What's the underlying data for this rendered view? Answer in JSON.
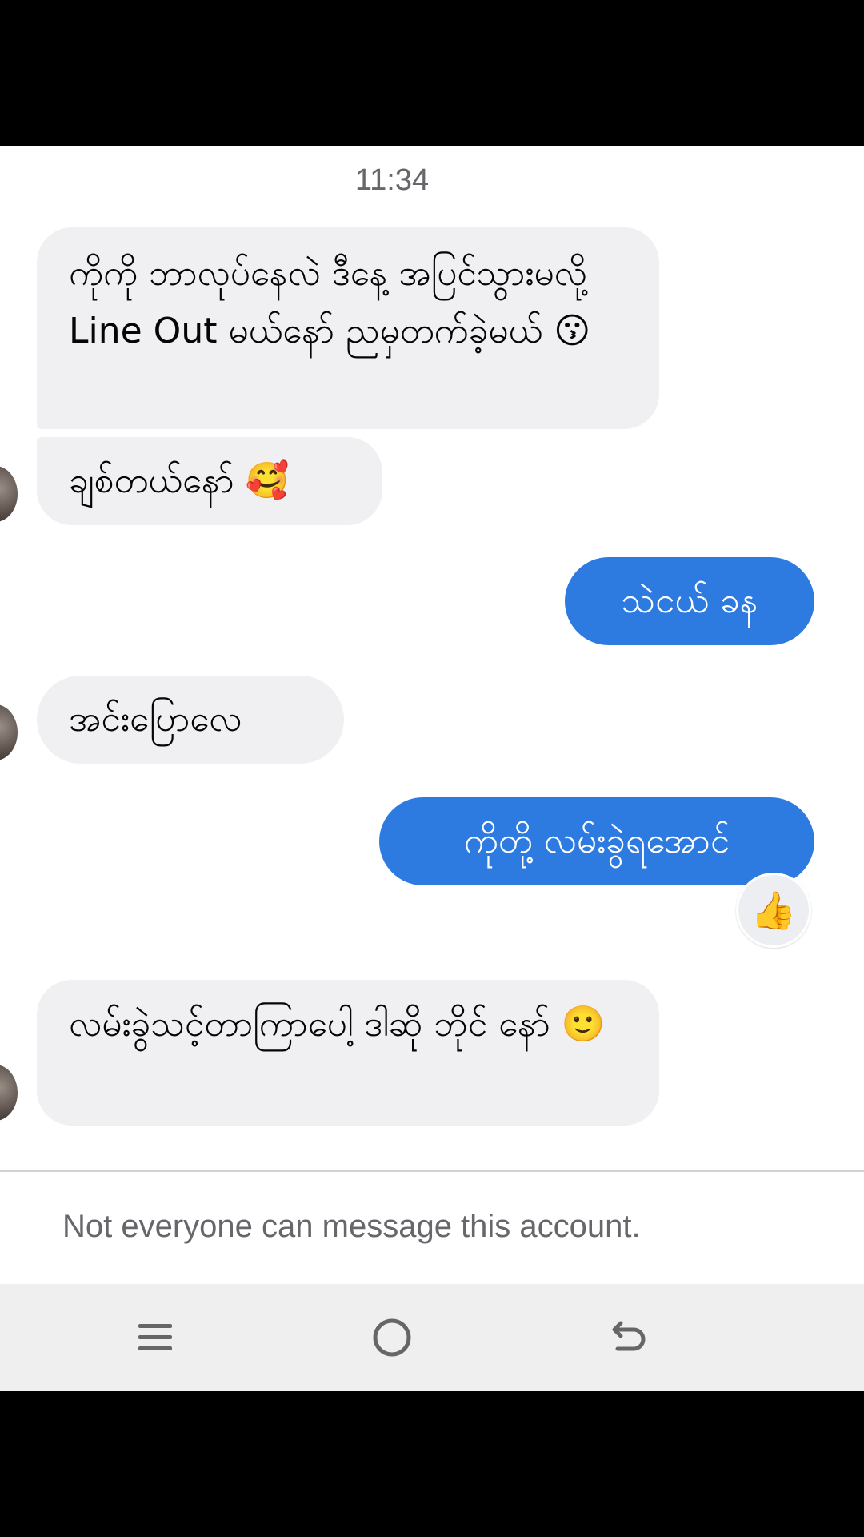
{
  "chat": {
    "timestamp": "11:34",
    "messages": [
      {
        "side": "incoming",
        "text": "ကိုကို ဘာလုပ်နေလဲ ဒီနေ့ အပြင်သွားမလို့ Line Out မယ်နော် ညမှတက်ခဲ့မယ်",
        "emoji": "😗"
      },
      {
        "side": "incoming",
        "text": "ချစ်တယ်နော်",
        "emoji": "🥰"
      },
      {
        "side": "outgoing",
        "text": "သဲငယ် ခန"
      },
      {
        "side": "incoming",
        "text": "အင်းပြောလေ"
      },
      {
        "side": "outgoing",
        "text": "ကိုတို့ လမ်းခွဲရအောင်",
        "reaction": "👍"
      },
      {
        "side": "incoming",
        "text": "လမ်းခွဲသင့်တာကြာပေါ့ ဒါဆို ဘိုင် နော်",
        "emoji": "🙂"
      }
    ]
  },
  "footer": {
    "notice": "Not everyone can message this account."
  },
  "nav": {
    "icons": [
      "menu-icon",
      "home-icon",
      "back-icon"
    ]
  },
  "colors": {
    "outgoing_bubble": "#2d7be0",
    "incoming_bubble": "#f0f0f3"
  }
}
